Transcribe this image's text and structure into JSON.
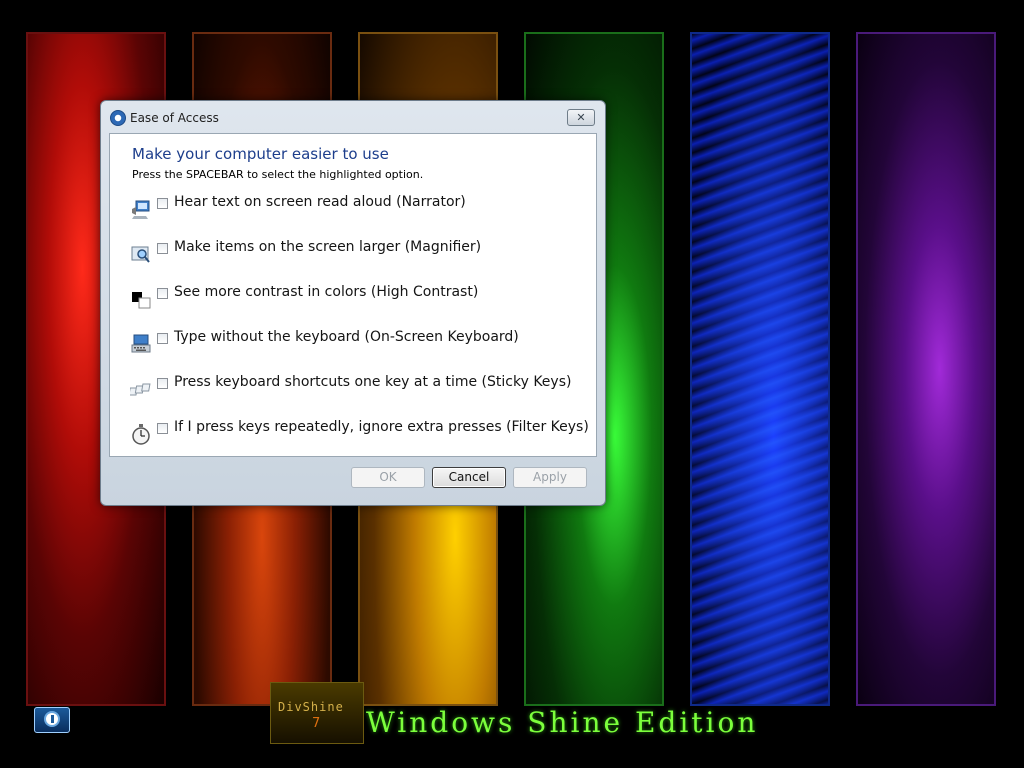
{
  "desktop": {
    "brand_name": "DivShine",
    "brand_number": "7",
    "edition_title": "Windows Shine Edition",
    "accent_green": "#7cff3c"
  },
  "taskbar": {
    "ease_of_access_icon": "ease-of-access-icon"
  },
  "dialog": {
    "title": "Ease of Access",
    "close_symbol": "✕",
    "heading": "Make your computer easier to use",
    "instruction": "Press the SPACEBAR to select the highlighted option.",
    "options": [
      {
        "label": "Hear text on screen read aloud (Narrator)",
        "icon": "narrator-icon",
        "checked": false
      },
      {
        "label": "Make items on the screen larger (Magnifier)",
        "icon": "magnifier-icon",
        "checked": false
      },
      {
        "label": "See more contrast in colors (High Contrast)",
        "icon": "high-contrast-icon",
        "checked": false
      },
      {
        "label": "Type without the keyboard (On-Screen Keyboard)",
        "icon": "keyboard-icon",
        "checked": false
      },
      {
        "label": "Press keyboard shortcuts one key at a time (Sticky Keys)",
        "icon": "sticky-keys-icon",
        "checked": false
      },
      {
        "label": "If I press keys repeatedly, ignore extra presses (Filter Keys)",
        "icon": "stopwatch-icon",
        "checked": false
      }
    ],
    "buttons": {
      "ok": "OK",
      "cancel": "Cancel",
      "apply": "Apply"
    }
  }
}
